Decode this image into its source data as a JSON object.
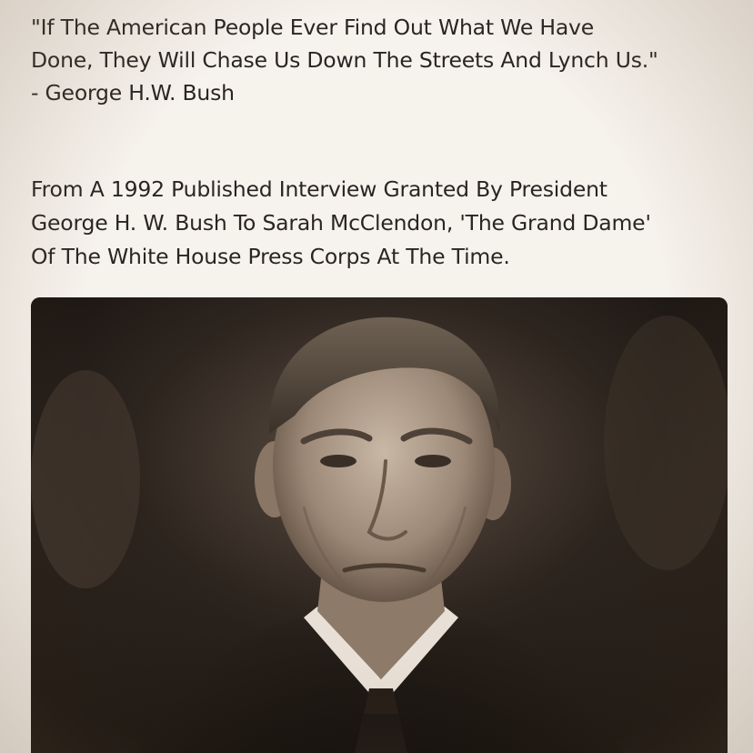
{
  "quote": {
    "lines": [
      "\"If The American People Ever Find Out What We Have",
      "Done, They Will Chase Us Down The Streets And Lynch Us.\"",
      "- George H.W. Bush"
    ]
  },
  "source": {
    "lines": [
      "From A 1992 Published Interview Granted By President",
      "George H. W. Bush To Sarah McClendon, 'The Grand Dame'",
      "Of The White House Press Corps At The Time."
    ]
  },
  "photo": {
    "subject": "portrait-photo",
    "tone": "sepia-black-and-white"
  },
  "colors": {
    "background": "#f6f2ec",
    "text": "#2a2522",
    "photo_dark": "#1c1612"
  }
}
